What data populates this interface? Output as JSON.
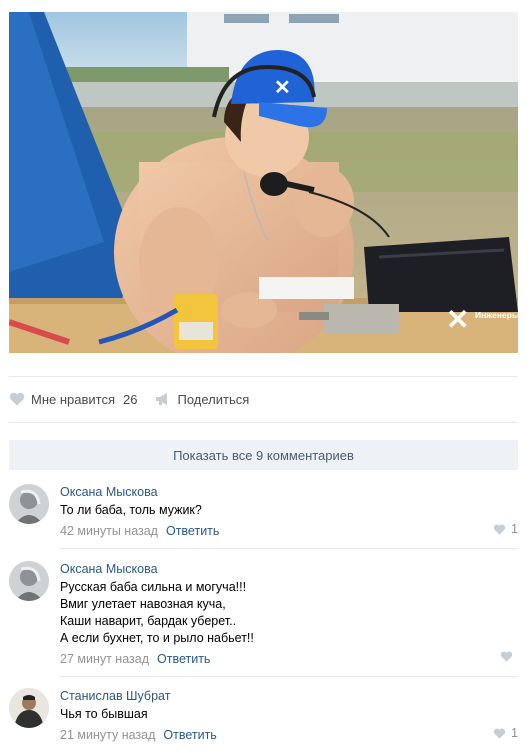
{
  "post": {
    "photo_watermark": "Инженеры будущего",
    "cap_logo_text": "Инженеры будущего"
  },
  "actions": {
    "like_label": "Мне нравится",
    "like_count": "26",
    "share_label": "Поделиться"
  },
  "comments_bar": {
    "show_all_label": "Показать все 9 комментариев"
  },
  "comments": [
    {
      "author": "Оксана Мыскова",
      "text": "То ли баба, толь мужик?",
      "time": "42 минуты назад",
      "reply_label": "Ответить",
      "likes": "1"
    },
    {
      "author": "Оксана Мыскова",
      "text": "Русская баба сильна и могуча!!!\nВмиг улетает навозная куча,\nКаши наварит, бардак уберет..\nА если бухнет, то и рыло набьет!!",
      "time": "27 минут назад",
      "reply_label": "Ответить",
      "likes": ""
    },
    {
      "author": "Станислав Шубрат",
      "text": "Чья то бывшая",
      "time": "21 минуту назад",
      "reply_label": "Ответить",
      "likes": "1"
    }
  ],
  "colors": {
    "link": "#2a5885",
    "meta": "#939393",
    "bar_bg": "#eef1f5",
    "cap": "#1f63d6"
  }
}
